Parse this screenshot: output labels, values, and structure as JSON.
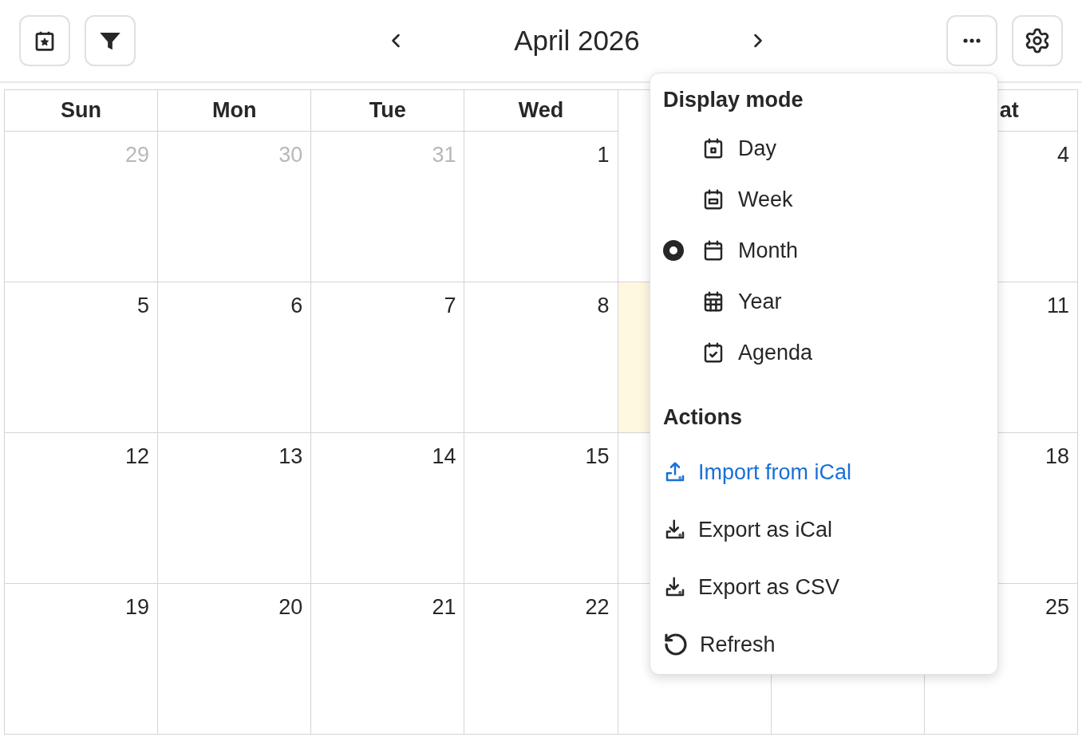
{
  "toolbar": {
    "title": "April 2026"
  },
  "calendar": {
    "headers": [
      {
        "label": "Sun",
        "kind": "full"
      },
      {
        "label": "Mon",
        "kind": "full"
      },
      {
        "label": "Tue",
        "kind": "full"
      },
      {
        "label": "Wed",
        "kind": "full"
      },
      {
        "label": "at",
        "kind": "clipped"
      }
    ],
    "weeks": [
      [
        {
          "day": "29",
          "muted": true,
          "today": false
        },
        {
          "day": "30",
          "muted": true,
          "today": false
        },
        {
          "day": "31",
          "muted": true,
          "today": false
        },
        {
          "day": "1",
          "muted": false,
          "today": false
        },
        {
          "today": false
        },
        {
          "day": "4",
          "muted": false,
          "today": false
        }
      ],
      [
        {
          "day": "5",
          "muted": false,
          "today": false
        },
        {
          "day": "6",
          "muted": false,
          "today": false
        },
        {
          "day": "7",
          "muted": false,
          "today": false
        },
        {
          "day": "8",
          "muted": false,
          "today": false
        },
        {
          "today": true
        },
        {
          "day": "11",
          "muted": false,
          "today": false
        }
      ],
      [
        {
          "day": "12",
          "muted": false,
          "today": false
        },
        {
          "day": "13",
          "muted": false,
          "today": false
        },
        {
          "day": "14",
          "muted": false,
          "today": false
        },
        {
          "day": "15",
          "muted": false,
          "today": false
        },
        {
          "today": false
        },
        {
          "day": "18",
          "muted": false,
          "today": false
        }
      ],
      [
        {
          "day": "19",
          "muted": false,
          "today": false
        },
        {
          "day": "20",
          "muted": false,
          "today": false
        },
        {
          "day": "21",
          "muted": false,
          "today": false
        },
        {
          "day": "22",
          "muted": false,
          "today": false
        },
        {
          "today": false
        },
        {
          "day": "25",
          "muted": false,
          "today": false
        }
      ]
    ]
  },
  "menu": {
    "display_title": "Display mode",
    "modes": [
      {
        "label": "Day",
        "kind": "day",
        "selected": false
      },
      {
        "label": "Week",
        "kind": "week",
        "selected": false
      },
      {
        "label": "Month",
        "kind": "month",
        "selected": true
      },
      {
        "label": "Year",
        "kind": "year",
        "selected": false
      },
      {
        "label": "Agenda",
        "kind": "agenda",
        "selected": false
      }
    ],
    "actions_title": "Actions",
    "actions": [
      {
        "label": "Import from iCal",
        "kind": "upload",
        "highlighted": true
      },
      {
        "label": "Export as iCal",
        "kind": "download",
        "highlighted": false
      },
      {
        "label": "Export as CSV",
        "kind": "download",
        "highlighted": false
      },
      {
        "label": "Refresh",
        "kind": "refresh",
        "highlighted": false
      }
    ]
  }
}
